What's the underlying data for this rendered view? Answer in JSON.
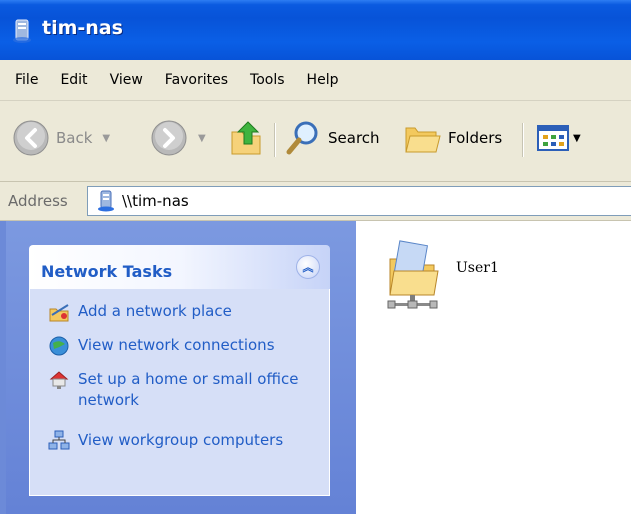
{
  "window": {
    "title": "tim-nas"
  },
  "menu": [
    "File",
    "Edit",
    "View",
    "Favorites",
    "Tools",
    "Help"
  ],
  "toolbar": {
    "back_label": "Back",
    "search_label": "Search",
    "folders_label": "Folders"
  },
  "address": {
    "label": "Address",
    "value": "\\\\tim-nas"
  },
  "tasks": {
    "title": "Network Tasks",
    "items": [
      {
        "label": "Add a network place",
        "icon": "add-network-place-icon"
      },
      {
        "label": "View network connections",
        "icon": "network-connections-icon"
      },
      {
        "label": "Set up a home or small office network",
        "icon": "home-network-icon"
      },
      {
        "label": "View workgroup computers",
        "icon": "workgroup-computers-icon"
      }
    ]
  },
  "content": {
    "items": [
      {
        "label": "User1",
        "icon": "shared-folder-icon"
      }
    ]
  },
  "colors": {
    "titlebar": "#0753d8",
    "task_link": "#215dc6",
    "taskpane": "#6482d6"
  }
}
